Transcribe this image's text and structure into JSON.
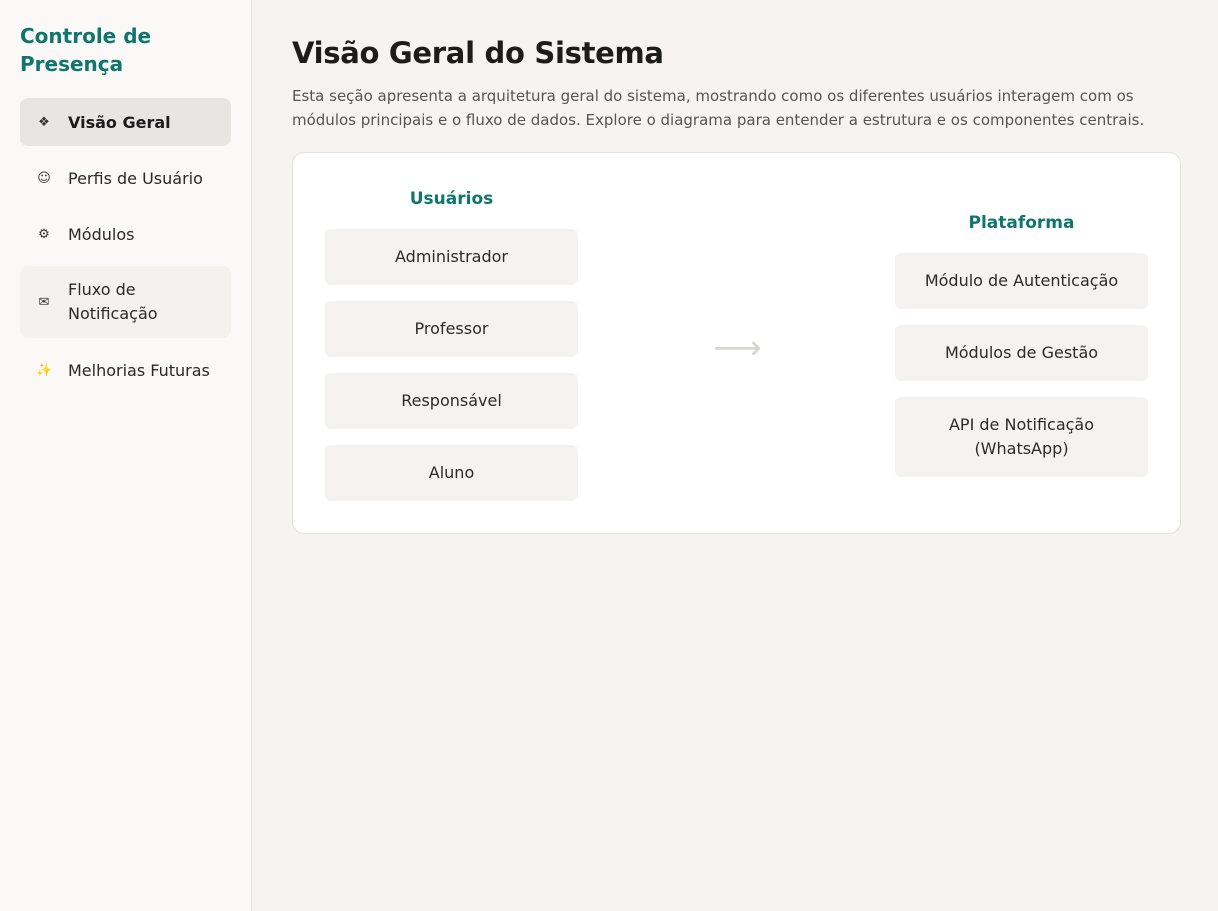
{
  "sidebar": {
    "brand": "Controle de Presença",
    "items": [
      {
        "icon": "❖",
        "icon_name": "diamond-icon",
        "label": "Visão Geral"
      },
      {
        "icon": "☺",
        "icon_name": "smiley-icon",
        "label": "Perfis de Usuário"
      },
      {
        "icon": "⚙",
        "icon_name": "gear-icon",
        "label": "Módulos"
      },
      {
        "icon": "✉",
        "icon_name": "envelope-icon",
        "label": "Fluxo de Notificação"
      },
      {
        "icon": "✨",
        "icon_name": "sparkles-icon",
        "label": "Melhorias Futuras"
      }
    ]
  },
  "main": {
    "title": "Visão Geral do Sistema",
    "intro": "Esta seção apresenta a arquitetura geral do sistema, mostrando como os diferentes usuários interagem com os módulos principais e o fluxo de dados. Explore o diagrama para entender a estrutura e os componentes centrais."
  },
  "diagram": {
    "users": {
      "title": "Usuários",
      "items": [
        "Administrador",
        "Professor",
        "Responsável",
        "Aluno"
      ]
    },
    "arrow": "⟶",
    "platform": {
      "title": "Plataforma",
      "items": [
        "Módulo de Autenticação",
        "Módulos de Gestão",
        "API de Notificação (WhatsApp)"
      ]
    }
  },
  "colors": {
    "accent": "#0f766e",
    "page_bg": "#f5f4f2",
    "sidebar_bg": "#faf9f7",
    "active_item_bg": "#e7e6e3",
    "box_bg": "#f4f3f1"
  }
}
